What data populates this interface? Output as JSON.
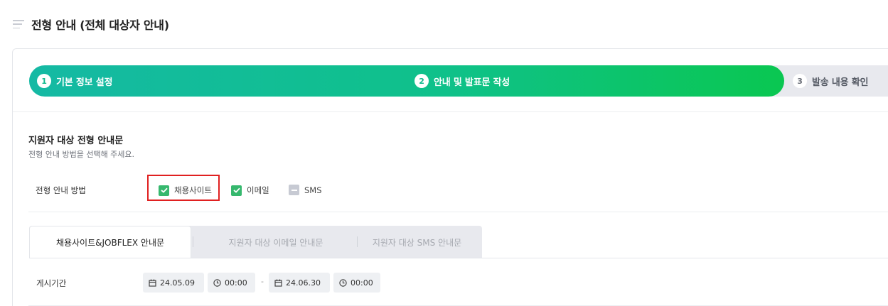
{
  "page": {
    "title": "전형 안내 (전체 대상자 안내)"
  },
  "stepper": {
    "steps": [
      {
        "num": "1",
        "label": "기본 정보 설정",
        "state": "active"
      },
      {
        "num": "2",
        "label": "안내 및 발표문 작성",
        "state": "active"
      },
      {
        "num": "3",
        "label": "발송 내용 확인",
        "state": "pending"
      }
    ],
    "active_gradient": [
      "#15b9a4",
      "#0ac751"
    ]
  },
  "section": {
    "title": "지원자 대상 전형 안내문",
    "subtitle": "전형 안내 방법을 선택해 주세요."
  },
  "method": {
    "label": "전형 안내 방법",
    "options": [
      {
        "label": "채용사이트",
        "checked": true,
        "highlighted": true
      },
      {
        "label": "이메일",
        "checked": true
      },
      {
        "label": "SMS",
        "checked": false
      }
    ]
  },
  "tabs": [
    {
      "label": "채용사이트&JOBFLEX 안내문",
      "active": true
    },
    {
      "label": "지원자 대상 이메일 안내문",
      "active": false
    },
    {
      "label": "지원자 대상 SMS 안내문",
      "active": false
    }
  ],
  "period": {
    "label": "게시기간",
    "start_date": "24.05.09",
    "start_time": "00:00",
    "separator": "-",
    "end_date": "24.06.30",
    "end_time": "00:00"
  },
  "colors": {
    "accent": "#0fc18a",
    "check": "#36b86e",
    "highlight": "#e02020"
  }
}
